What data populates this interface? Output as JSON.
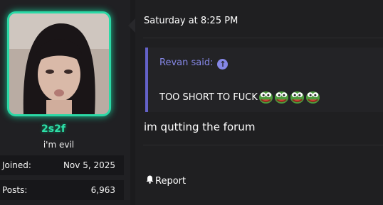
{
  "user": {
    "name": "2s2f",
    "title": "i'm evil",
    "stats": [
      {
        "label": "Joined:",
        "value": "Nov 5, 2025"
      },
      {
        "label": "Posts:",
        "value": "6,963"
      }
    ],
    "accent_color": "#2bd9a6"
  },
  "post": {
    "timestamp": "Saturday at 8:25 PM",
    "quote": {
      "author_line": "Revan said:",
      "icon": "arrow-up-circle-icon",
      "text": "TOO SHORT TO FUCK",
      "emote_icon": "pepe-frog-emote-icon"
    },
    "message": "im qutting the forum",
    "actions": {
      "report_label": "Report",
      "report_icon": "bell-icon"
    }
  },
  "colors": {
    "quote_accent": "#6462c8",
    "username": "#2ee0a8",
    "background": "#1b1b1d"
  }
}
